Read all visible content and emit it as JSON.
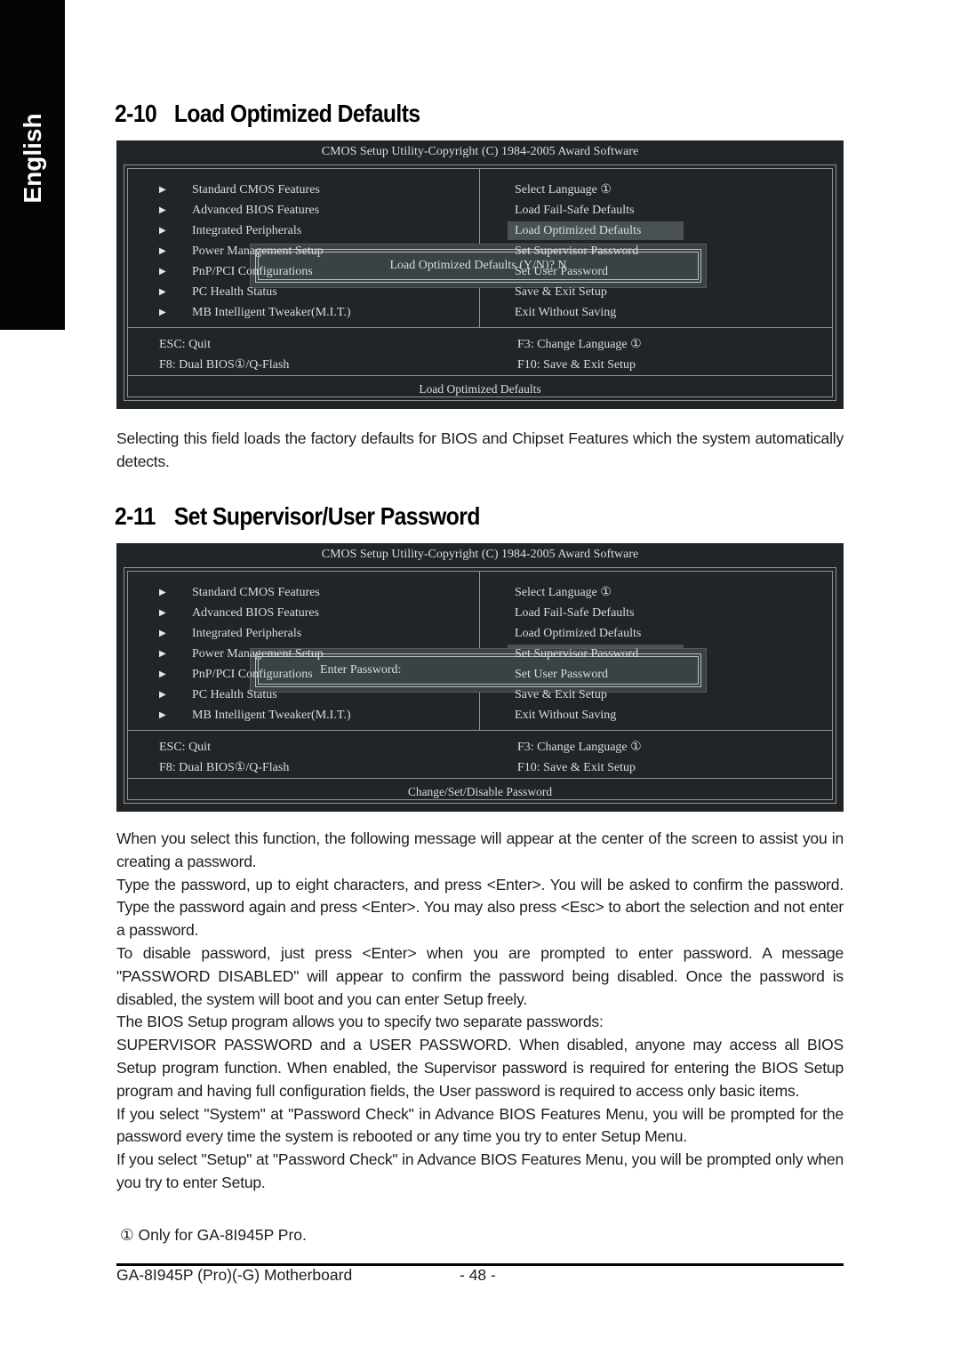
{
  "side_tab": {
    "label": "English"
  },
  "section_1": {
    "number": "2-10",
    "title": "Load Optimized Defaults",
    "bios": {
      "title": "CMOS Setup Utility-Copyright (C) 1984-2005 Award Software",
      "left_menu": [
        "Standard CMOS Features",
        "Advanced BIOS Features",
        "Integrated Peripherals",
        "Power Management Setup",
        "PnP/PCI Configurations",
        "PC Health Status",
        "MB Intelligent Tweaker(M.I.T.)"
      ],
      "right_menu": [
        "Select Language ①",
        "Load Fail-Safe Defaults",
        "Load Optimized Defaults",
        "Set Supervisor Password",
        "Set User Password",
        "Save & Exit Setup",
        "Exit Without Saving"
      ],
      "selected_right_index": 2,
      "keys": {
        "esc": "ESC: Quit",
        "f3": "F3: Change Language ①",
        "f8": "F8: Dual BIOS①/Q-Flash",
        "f10": "F10: Save & Exit Setup"
      },
      "status": "Load Optimized Defaults",
      "dialog": "Load Optimized Defaults (Y/N)? N"
    },
    "description": "Selecting this field loads the factory defaults for BIOS and Chipset Features which the system automatically detects."
  },
  "section_2": {
    "number": "2-11",
    "title": "Set Supervisor/User Password",
    "bios": {
      "title": "CMOS Setup Utility-Copyright (C) 1984-2005 Award Software",
      "left_menu": [
        "Standard CMOS Features",
        "Advanced BIOS Features",
        "Integrated Peripherals",
        "Power Management Setup",
        "PnP/PCI Configurations",
        "PC Health Status",
        "MB Intelligent Tweaker(M.I.T.)"
      ],
      "right_menu": [
        "Select Language ①",
        "Load Fail-Safe Defaults",
        "Load Optimized Defaults",
        "Set Supervisor Password",
        "Set User Password",
        "Save & Exit Setup",
        "Exit Without Saving"
      ],
      "selected_right_index": 3,
      "keys": {
        "esc": "ESC: Quit",
        "f3": "F3: Change Language ①",
        "f8": "F8: Dual BIOS①/Q-Flash",
        "f10": "F10: Save & Exit Setup"
      },
      "status": "Change/Set/Disable Password",
      "dialog": "Enter Password:"
    },
    "paragraphs": [
      "When you select this function, the following message will appear at the center of the screen to assist you in creating a password.",
      "Type the password, up to eight characters, and press <Enter>. You will be asked to confirm the password. Type the password again and press <Enter>. You may also press <Esc> to abort the selection and not enter a password.",
      "To disable password, just press <Enter> when you are prompted to enter password. A message \"PASSWORD DISABLED\" will appear to confirm the password being disabled. Once the password is disabled, the system will boot and you can enter Setup freely.",
      "The BIOS Setup program allows you to specify two separate passwords:",
      "SUPERVISOR PASSWORD and a USER PASSWORD. When disabled, anyone may access all BIOS Setup program function. When enabled, the Supervisor password is required for entering the BIOS Setup program and having full configuration fields, the User password is required to access only basic items.",
      "If you select \"System\" at \"Password Check\" in Advance BIOS Features Menu, you will be prompted for the password every time the system is rebooted or any time you try to enter Setup Menu.",
      "If you select \"Setup\" at \"Password Check\" in Advance BIOS Features Menu, you will be prompted only when you try to enter Setup."
    ]
  },
  "footnote": "① Only for GA-8I945P Pro.",
  "footer": {
    "product": "GA-8I945P (Pro)(-G) Motherboard",
    "page": "- 48 -"
  }
}
